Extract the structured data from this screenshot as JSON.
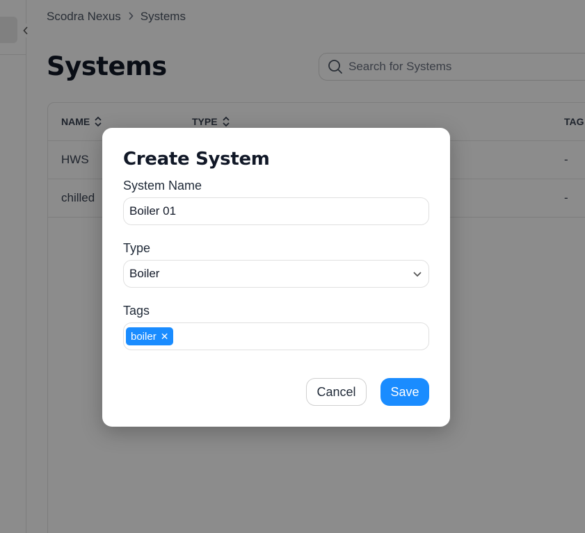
{
  "breadcrumb": {
    "root": "Scodra Nexus",
    "current": "Systems"
  },
  "page": {
    "title": "Systems"
  },
  "search": {
    "placeholder": "Search for Systems"
  },
  "table": {
    "columns": [
      "NAME",
      "TYPE",
      "TAG"
    ],
    "rows": [
      {
        "name": "HWS",
        "tags": "-"
      },
      {
        "name": "chilled",
        "tags": "-"
      }
    ]
  },
  "modal": {
    "title": "Create System",
    "system_name_label": "System Name",
    "system_name_value": "Boiler 01",
    "type_label": "Type",
    "type_value": "Boiler",
    "tags_label": "Tags",
    "tags": [
      "boiler"
    ],
    "cancel_label": "Cancel",
    "save_label": "Save"
  },
  "colors": {
    "accent": "#1a8cff",
    "overlay": "rgba(0,0,0,0.45)"
  },
  "icons": {
    "search": "search-icon",
    "sort": "sort-icon",
    "chevron": "chevron-down-icon",
    "remove": "close-icon"
  }
}
